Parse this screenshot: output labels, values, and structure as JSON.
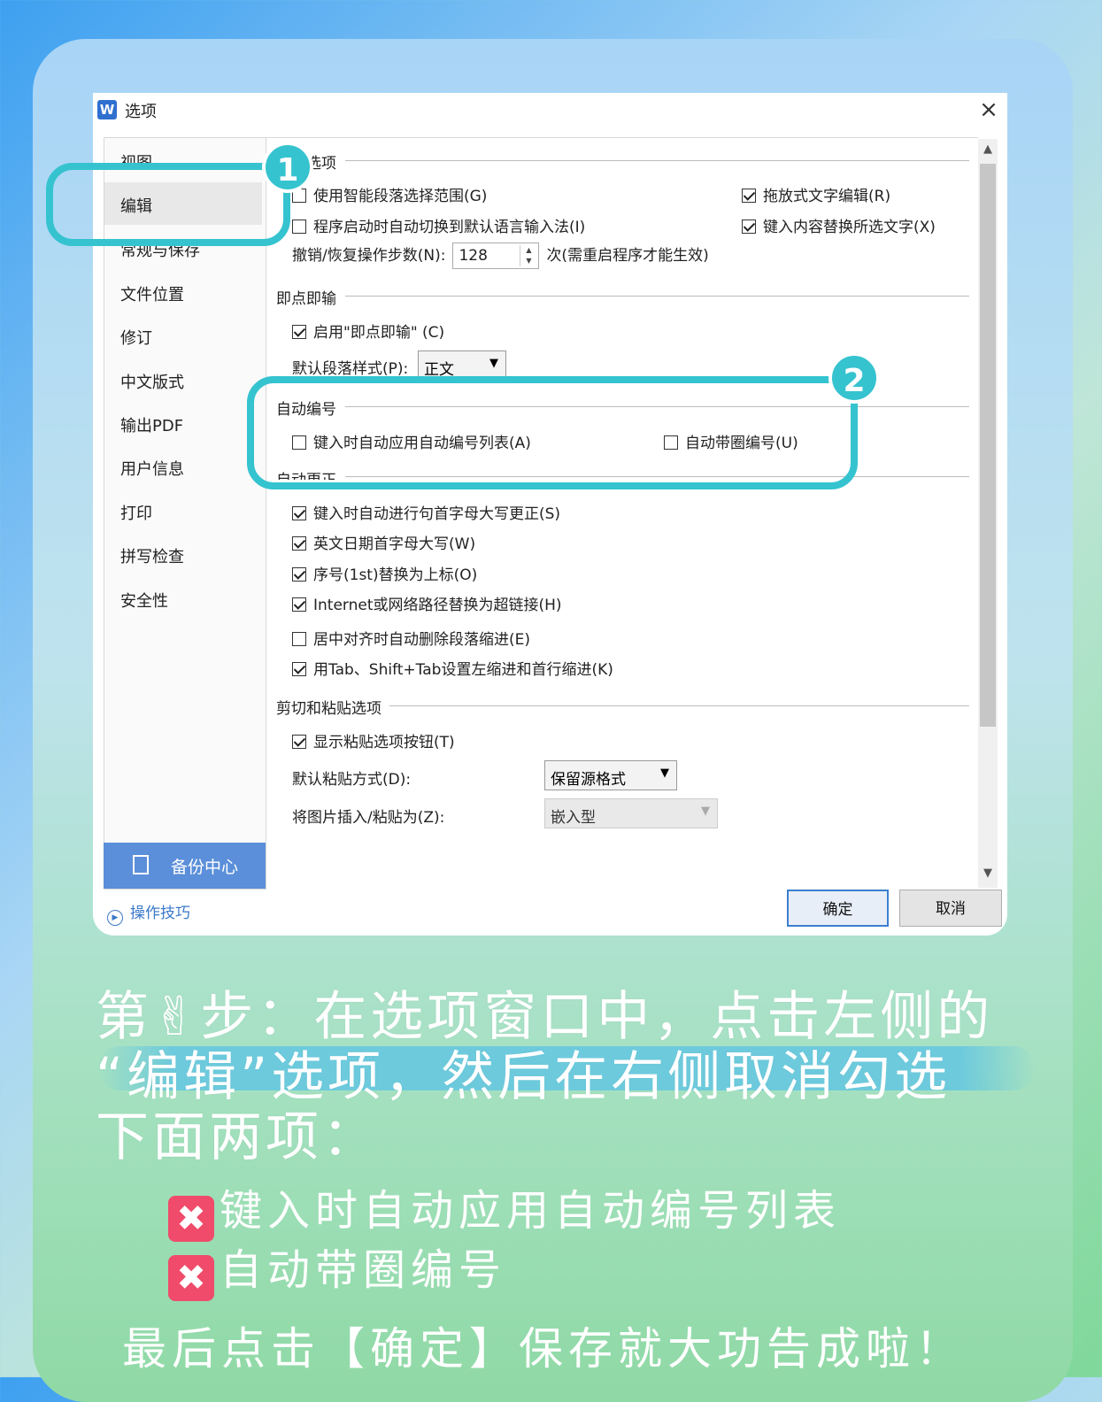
{
  "dialog": {
    "title": "选项",
    "app_icon": "W",
    "close_glyph": "×",
    "sidebar": [
      "视图",
      "编辑",
      "常规与保存",
      "文件位置",
      "修订",
      "中文版式",
      "输出PDF",
      "用户信息",
      "打印",
      "拼写检查",
      "安全性"
    ],
    "backup_label": "备份中心",
    "tips_label": "操作技巧",
    "edit_section": {
      "title": "编辑选项",
      "smart_para": "使用智能段落选择范围(G)",
      "auto_ime": "程序启动时自动切换到默认语言输入法(I)",
      "drag_edit": "拖放式文字编辑(R)",
      "replace_sel": "键入内容替换所选文字(X)",
      "undo_label": "撤销/恢复操作步数(N):",
      "undo_value": "128",
      "undo_note": "次(需重启程序才能生效)"
    },
    "click_type": {
      "title": "即点即输",
      "enable": "启用\"即点即输\" (C)",
      "default_style_label": "默认段落样式(P):",
      "default_style_value": "正文"
    },
    "auto_number": {
      "title": "自动编号",
      "list": "键入时自动应用自动编号列表(A)",
      "circle": "自动带圈编号(U)"
    },
    "auto_correct": {
      "title": "自动更正",
      "items": [
        "键入时自动进行句首字母大写更正(S)",
        "英文日期首字母大写(W)",
        "序号(1st)替换为上标(O)",
        "Internet或网络路径替换为超链接(H)",
        "居中对齐时自动删除段落缩进(E)",
        "用Tab、Shift+Tab设置左缩进和首行缩进(K)"
      ]
    },
    "paste": {
      "title": "剪切和粘贴选项",
      "show_button": "显示粘贴选项按钮(T)",
      "default_label": "默认粘贴方式(D):",
      "default_value": "保留源格式",
      "image_label": "将图片插入/粘贴为(Z):",
      "image_value": "嵌入型"
    },
    "ok": "确定",
    "cancel": "取消"
  },
  "badges": {
    "one": "1",
    "two": "2"
  },
  "caption": {
    "line1": "第✌步：在选项窗口中，点击左侧的",
    "line2": "“编辑”选项，然后在右侧取消勾选",
    "line3": "下面两项：",
    "x_glyph": "✖",
    "item1": "键入时自动应用自动编号列表",
    "item2": "自动带圈编号",
    "final": "最后点击【确定】保存就大功告成啦！"
  },
  "colors": {
    "highlight": "#35c3cf",
    "accent": "#5b8fd9",
    "x_icon": "#f04b6a"
  },
  "icons": {
    "backup": "backup-icon",
    "tips": "play-circle-icon",
    "close": "close-icon"
  }
}
